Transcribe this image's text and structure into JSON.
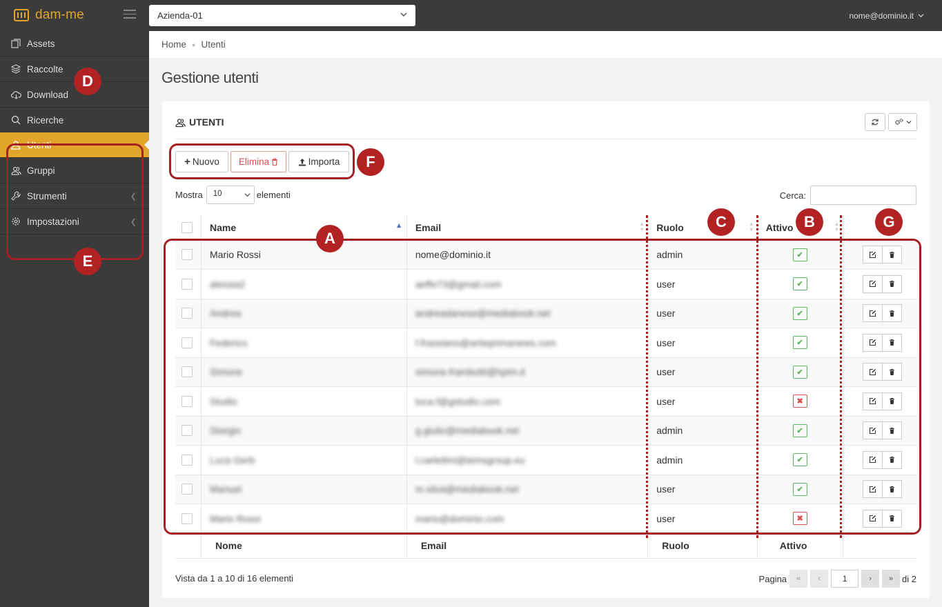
{
  "header": {
    "logo_text": "dam-me",
    "company_select": "Azienda-01",
    "user_email": "nome@dominio.it"
  },
  "sidebar": {
    "items": [
      {
        "label": "Assets",
        "icon": "assets-icon"
      },
      {
        "label": "Raccolte",
        "icon": "layers-icon"
      },
      {
        "label": "Download",
        "icon": "cloud-download-icon"
      },
      {
        "label": "Ricerche",
        "icon": "search-icon"
      },
      {
        "label": "Utenti",
        "icon": "user-icon",
        "active": true
      },
      {
        "label": "Gruppi",
        "icon": "users-icon"
      },
      {
        "label": "Strumenti",
        "icon": "wrench-icon",
        "has_submenu": true
      },
      {
        "label": "Impostazioni",
        "icon": "gear-icon",
        "has_submenu": true
      }
    ]
  },
  "breadcrumb": {
    "home": "Home",
    "current": "Utenti"
  },
  "page_title": "Gestione utenti",
  "card": {
    "title": "UTENTI"
  },
  "toolbar": {
    "new_label": "Nuovo",
    "delete_label": "Elimina",
    "import_label": "Importa"
  },
  "length": {
    "label_before": "Mostra",
    "value": "10",
    "label_after": "elementi"
  },
  "search": {
    "label": "Cerca:",
    "value": ""
  },
  "table": {
    "headers": [
      "Name",
      "Email",
      "Ruolo",
      "Attivo"
    ],
    "rows": [
      {
        "name": "Mario Rossi",
        "email": "nome@dominio.it",
        "role": "admin",
        "active": true
      },
      {
        "name": "alessia2",
        "email": "aeffe73@gmail.com",
        "role": "user",
        "active": true
      },
      {
        "name": "Andrea",
        "email": "andreadanese@mediabook.net",
        "role": "user",
        "active": true
      },
      {
        "name": "Federico",
        "email": "f.frassiano@anteprimanews.com",
        "role": "user",
        "active": true
      },
      {
        "name": "Simone",
        "email": "simone.frambotti@hpim.it",
        "role": "user",
        "active": true
      },
      {
        "name": "Studio",
        "email": "luca.f@gstudio.com",
        "role": "user",
        "active": false
      },
      {
        "name": "Giorgio",
        "email": "g.giulio@mediabook.net",
        "role": "admin",
        "active": true
      },
      {
        "name": "Luca Gerb",
        "email": "l.carlettini@temsgroup.eu",
        "role": "admin",
        "active": true
      },
      {
        "name": "Manuel",
        "email": "m.silva@mediabook.net",
        "role": "user",
        "active": true
      },
      {
        "name": "Mario Rossi",
        "email": "mario@dominio.com",
        "role": "user",
        "active": false
      }
    ],
    "footers": [
      "Nome",
      "Email",
      "Ruolo",
      "Attivo"
    ]
  },
  "info": "Vista da 1 a 10 di 16 elementi",
  "pagination": {
    "label": "Pagina",
    "current": "1",
    "total_label": "di 2"
  },
  "annotations": [
    "A",
    "B",
    "C",
    "D",
    "E",
    "F",
    "G"
  ],
  "colors": {
    "accent": "#e0a52a",
    "sidebar": "#3b3b3b",
    "annotation": "#a52121"
  }
}
